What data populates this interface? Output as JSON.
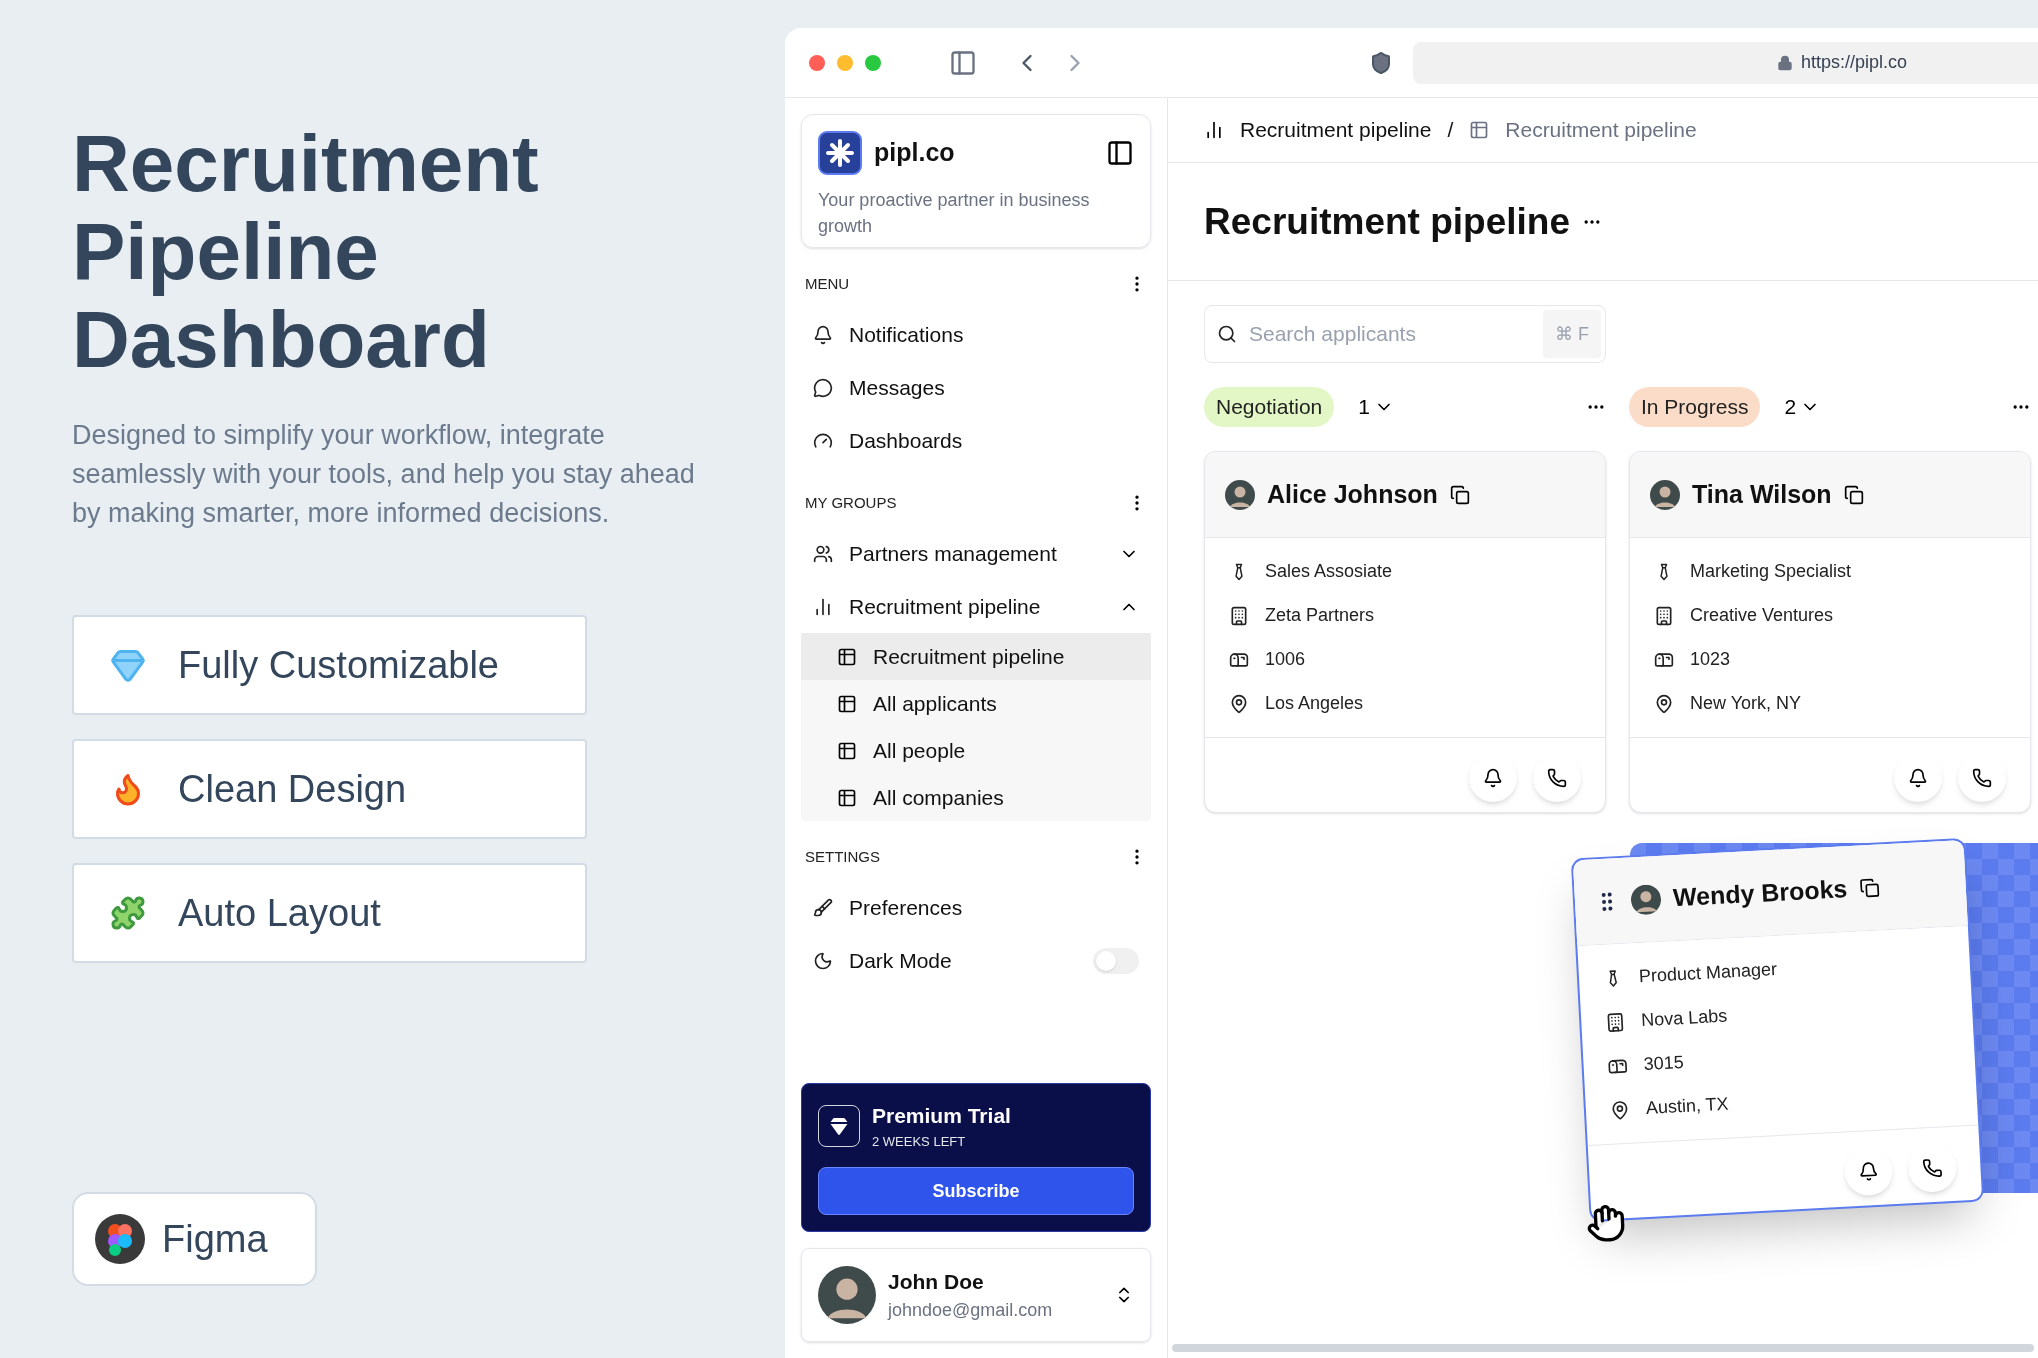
{
  "hero": {
    "title": "Recruitment Pipeline Dashboard",
    "description": "Designed to simplify your workflow, integrate seamlessly with your tools, and help you stay ahead by making smarter, more informed decisions.",
    "features": [
      {
        "label": "Fully Customizable"
      },
      {
        "label": "Clean Design"
      },
      {
        "label": "Auto Layout"
      }
    ],
    "tool": "Figma"
  },
  "browser": {
    "url": "https://pipl.co"
  },
  "sidebar": {
    "brand": "pipl.co",
    "tagline": "Your proactive partner in business growth",
    "sections": [
      {
        "title": "MENU",
        "items": [
          {
            "kind": "link",
            "label": "Notifications"
          },
          {
            "kind": "link",
            "label": "Messages"
          },
          {
            "kind": "link",
            "label": "Dashboards"
          }
        ]
      },
      {
        "title": "MY GROUPS",
        "items": [
          {
            "kind": "group",
            "label": "Partners management",
            "expanded": false
          },
          {
            "kind": "group",
            "label": "Recruitment pipeline",
            "expanded": true,
            "children": [
              {
                "label": "Recruitment pipeline",
                "selected": true
              },
              {
                "label": "All applicants",
                "selected": false
              },
              {
                "label": "All people",
                "selected": false
              },
              {
                "label": "All companies",
                "selected": false
              }
            ]
          }
        ]
      },
      {
        "title": "SETTINGS",
        "items": [
          {
            "kind": "link",
            "label": "Preferences"
          },
          {
            "kind": "toggle",
            "label": "Dark Mode",
            "on": false
          }
        ]
      }
    ],
    "premium": {
      "title": "Premium Trial",
      "subtitle": "2 WEEKS LEFT",
      "button": "Subscribe"
    },
    "user": {
      "name": "John Doe",
      "email": "johndoe@gmail.com"
    }
  },
  "breadcrumb": [
    "Recruitment pipeline",
    "Recruitment pipeline"
  ],
  "breadcrumb_separator": "/",
  "page_title": "Recruitment pipeline",
  "search": {
    "placeholder": "Search applicants",
    "shortcut": "⌘ F"
  },
  "columns": [
    {
      "status": "Negotiation",
      "color": "#e3f7c6",
      "count": "1",
      "cards": [
        {
          "name": "Alice Johnson",
          "role": "Sales Assosiate",
          "company": "Zeta Partners",
          "number": "1006",
          "location": "Los Angeles"
        }
      ]
    },
    {
      "status": "In Progress",
      "color": "#fbdcc8",
      "count": "2",
      "cards": [
        {
          "name": "Tina Wilson",
          "role": "Marketing Specialist",
          "company": "Creative Ventures",
          "number": "1023",
          "location": "New York, NY"
        }
      ]
    }
  ],
  "dragged_card": {
    "name": "Wendy Brooks",
    "role": "Product Manager",
    "company": "Nova Labs",
    "number": "3015",
    "location": "Austin, TX"
  }
}
